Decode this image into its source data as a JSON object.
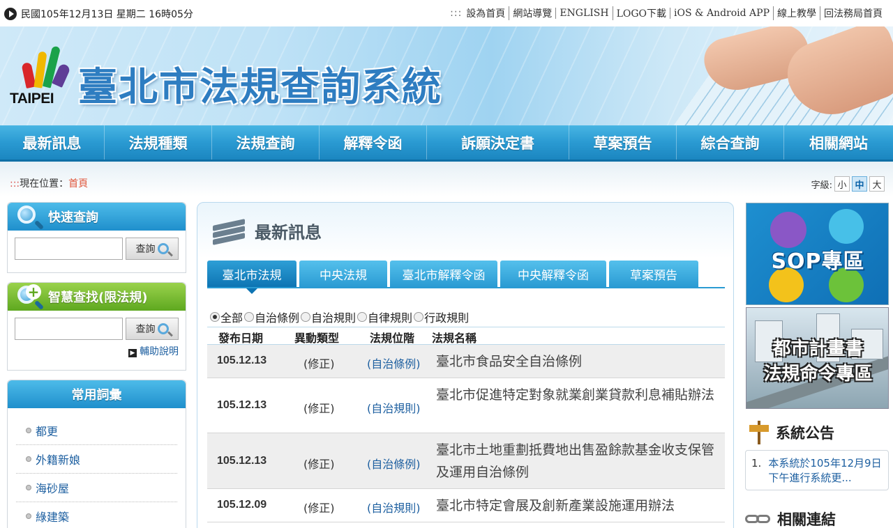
{
  "topbar": {
    "date": "民國105年12月13日 星期二 16時05分",
    "dots": ":::",
    "links": [
      "設為首頁",
      "網站導覽",
      "ENGLISH",
      "LOGO下載",
      "iOS & Android APP",
      "線上教學",
      "回法務局首頁"
    ]
  },
  "banner": {
    "logo_text": "TAIPEI",
    "title": "臺北市法規查詢系統"
  },
  "nav": {
    "items": [
      "最新訊息",
      "法規種類",
      "法規查詢",
      "解釋令函",
      "訴願決定書",
      "草案預告",
      "綜合查詢",
      "相關網站"
    ]
  },
  "breadcrumb": {
    "prefix": ":::",
    "label": "現在位置：",
    "home": "首頁"
  },
  "font_size": {
    "label": "字級:",
    "options": [
      "小",
      "中",
      "大"
    ],
    "selected": "中"
  },
  "quick_search": {
    "title": "快速查詢",
    "value": "",
    "button": "查詢"
  },
  "smart_search": {
    "title": "智慧查找(限法規)",
    "value": "",
    "button": "查詢",
    "help": "輔助說明"
  },
  "terms": {
    "title": "常用詞彙",
    "items": [
      "都更",
      "外籍新娘",
      "海砂屋",
      "綠建築"
    ]
  },
  "news": {
    "title": "最新訊息",
    "tabs": [
      "臺北市法規",
      "中央法規",
      "臺北市解釋令函",
      "中央解釋令函",
      "草案預告"
    ],
    "active_tab": "臺北市法規",
    "filters": [
      "全部",
      "自治條例",
      "自治規則",
      "自律規則",
      "行政規則"
    ],
    "selected_filter": "全部",
    "columns": [
      "發布日期",
      "異動類型",
      "法規位階",
      "法規名稱"
    ],
    "rows": [
      {
        "date": "105.12.13",
        "change": "(修正)",
        "level": "(自治條例)",
        "name": "臺北市食品安全自治條例"
      },
      {
        "date": "105.12.13",
        "change": "(修正)",
        "level": "(自治規則)",
        "name": "臺北市促進特定對象就業創業貸款利息補貼辦法"
      },
      {
        "date": "105.12.13",
        "change": "(修正)",
        "level": "(自治條例)",
        "name": "臺北市土地重劃抵費地出售盈餘款基金收支保管及運用自治條例"
      },
      {
        "date": "105.12.09",
        "change": "(修正)",
        "level": "(自治規則)",
        "name": "臺北市特定會展及創新產業設施運用辦法"
      }
    ]
  },
  "side_banners": {
    "sop": "SOP專區",
    "city_line1": "都市計畫書",
    "city_line2": "法規命令專區"
  },
  "notice": {
    "title": "系統公告",
    "items": [
      {
        "num": "1.",
        "text": "本系統於105年12月9日下午進行系統更..."
      }
    ]
  },
  "links": {
    "title": "相關連結"
  }
}
